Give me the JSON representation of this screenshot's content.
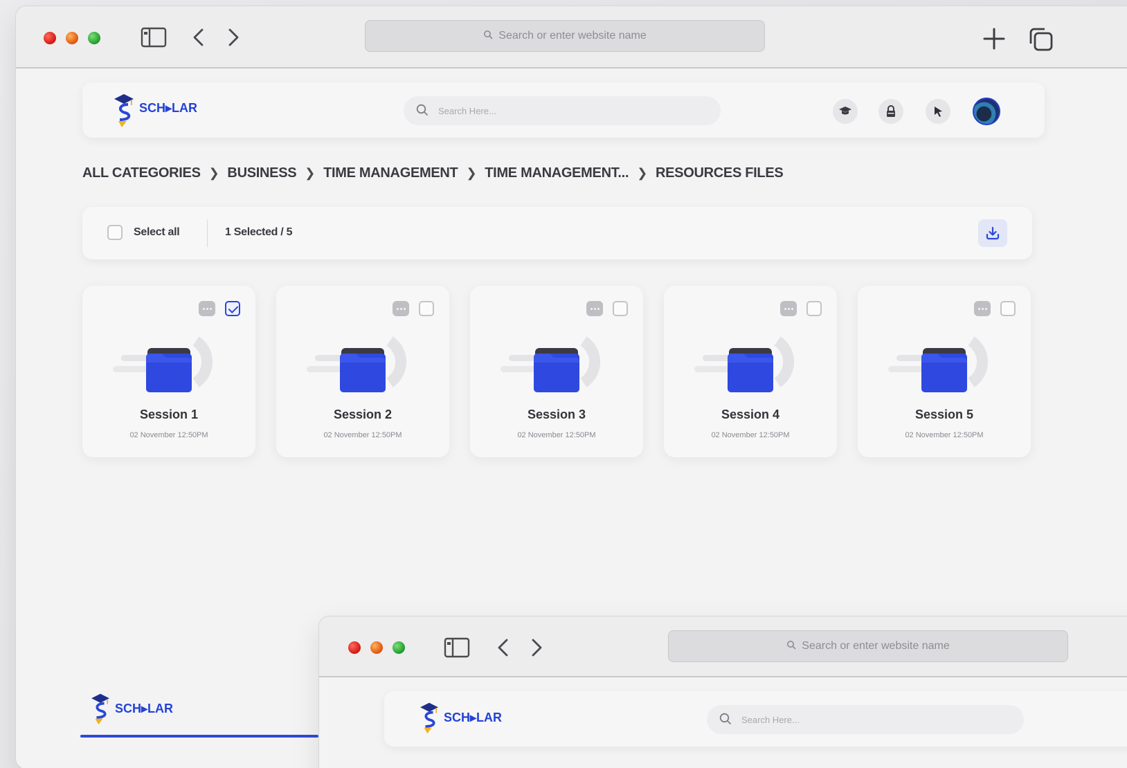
{
  "browser": {
    "url_placeholder": "Search or enter website name"
  },
  "app": {
    "logo_text": "SCH▸LAR",
    "search_placeholder": "Search Here..."
  },
  "breadcrumb": {
    "items": [
      "ALL CATEGORIES",
      "BUSINESS",
      "TIME MANAGEMENT",
      "TIME MANAGEMENT...",
      "RESOURCES FILES"
    ]
  },
  "selection": {
    "select_all_label": "Select all",
    "selected_count": "1 Selected / 5"
  },
  "cards": [
    {
      "title": "Session 1",
      "date": "02 November 12:50PM",
      "checked": true
    },
    {
      "title": "Session 2",
      "date": "02 November 12:50PM",
      "checked": false
    },
    {
      "title": "Session 3",
      "date": "02 November 12:50PM",
      "checked": false
    },
    {
      "title": "Session 4",
      "date": "02 November 12:50PM",
      "checked": false
    },
    {
      "title": "Session 5",
      "date": "02 November 12:50PM",
      "checked": false
    }
  ],
  "colors": {
    "accent": "#2a48d4",
    "folder": "#2f49e0",
    "folder_tab": "#3a3a44"
  },
  "icons": {
    "window_controls": [
      "close-dot",
      "minimize-dot",
      "zoom-dot"
    ],
    "toolbar": [
      "sidebar-icon",
      "back-icon",
      "forward-icon",
      "new-tab-icon",
      "tabs-overview-icon"
    ],
    "header": [
      "graduation-cap-icon",
      "lock-icon",
      "pointer-icon",
      "avatar"
    ],
    "selection": [
      "download-icon"
    ]
  }
}
